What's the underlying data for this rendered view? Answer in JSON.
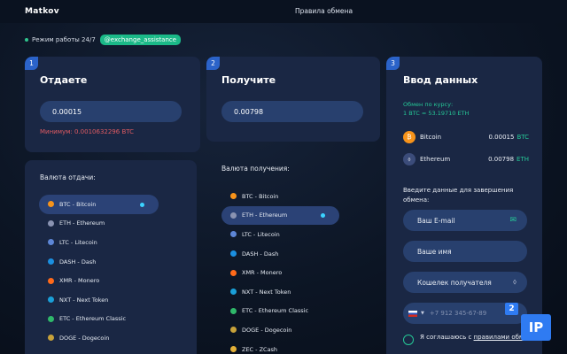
{
  "header": {
    "logo": "Matkov",
    "nav_link": "Правила обмена"
  },
  "status": {
    "work_mode": "Режим работы 24/7",
    "telegram": "@exchange_assistance"
  },
  "give": {
    "step": "1",
    "title": "Отдаете",
    "amount": "0.00015",
    "minimum": "Минимум: 0.0010632296 BTC",
    "list_title": "Валюта отдачи:",
    "currencies": [
      {
        "label": "BTC - Bitcoin",
        "icon": "bitcoin-icon",
        "coin": "btc"
      },
      {
        "label": "ETH - Ethereum",
        "icon": "ethereum-icon",
        "coin": "eth"
      },
      {
        "label": "LTC - Litecoin",
        "icon": "litecoin-icon",
        "coin": "ltc"
      },
      {
        "label": "DASH - Dash",
        "icon": "dash-icon",
        "coin": "dash"
      },
      {
        "label": "XMR - Monero",
        "icon": "monero-icon",
        "coin": "xmr"
      },
      {
        "label": "NXT - Next Token",
        "icon": "nxt-icon",
        "coin": "nxt"
      },
      {
        "label": "ETC - Ethereum Classic",
        "icon": "ethereum-classic-icon",
        "coin": "etc"
      },
      {
        "label": "DOGE - Dogecoin",
        "icon": "dogecoin-icon",
        "coin": "doge"
      }
    ],
    "active_index": 0
  },
  "receive": {
    "step": "2",
    "title": "Получите",
    "amount": "0.00798",
    "list_title": "Валюта получения:",
    "currencies": [
      {
        "label": "BTC - Bitcoin",
        "icon": "bitcoin-icon",
        "coin": "btc"
      },
      {
        "label": "ETH - Ethereum",
        "icon": "ethereum-icon",
        "coin": "eth"
      },
      {
        "label": "LTC - Litecoin",
        "icon": "litecoin-icon",
        "coin": "ltc"
      },
      {
        "label": "DASH - Dash",
        "icon": "dash-icon",
        "coin": "dash"
      },
      {
        "label": "XMR - Monero",
        "icon": "monero-icon",
        "coin": "xmr"
      },
      {
        "label": "NXT - Next Token",
        "icon": "nxt-icon",
        "coin": "nxt"
      },
      {
        "label": "ETC - Ethereum Classic",
        "icon": "ethereum-classic-icon",
        "coin": "etc"
      },
      {
        "label": "DOGE - Dogecoin",
        "icon": "dogecoin-icon",
        "coin": "doge"
      },
      {
        "label": "ZEC - ZCash",
        "icon": "zcash-icon",
        "coin": "zec"
      }
    ],
    "active_index": 1
  },
  "details": {
    "step": "3",
    "title": "Ввод данных",
    "rate_label": "Обмен по курсу:",
    "rate_value": "1 BTC = 53.19710 ETH",
    "summary": [
      {
        "name": "Bitcoin",
        "amount": "0.00015",
        "ticker": "BTC",
        "glyph": "₿",
        "coin": "btc"
      },
      {
        "name": "Ethereum",
        "amount": "0.00798",
        "ticker": "ETH",
        "glyph": "⬨",
        "coin": "eth"
      }
    ],
    "form_title": "Введите данные для завершения обмена:",
    "email_placeholder": "Ваш E-mail",
    "name_placeholder": "Ваше имя",
    "wallet_placeholder": "Кошелек получателя",
    "phone_placeholder": "+7 912 345-67-89",
    "agree_text": "Я соглашаюсь с ",
    "agree_link": "правилами обмена"
  },
  "watermark": {
    "big": "IP",
    "small": "2"
  },
  "colors": {
    "accent_green": "#25c997",
    "accent_blue": "#2b63c9",
    "panel": "#1a2744",
    "input": "#28406e",
    "warning": "#e05b62"
  }
}
